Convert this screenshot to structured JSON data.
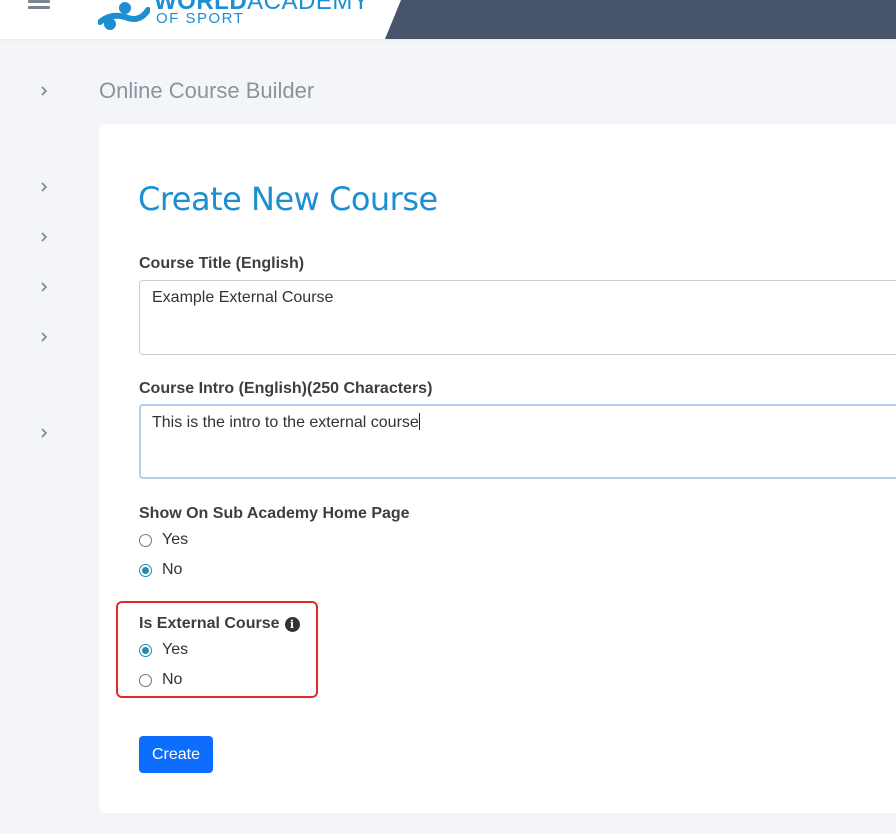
{
  "header": {
    "logo_brand_bold": "WORLD",
    "logo_brand_light": "ACADEMY",
    "logo_subtitle": "OF SPORT",
    "menu_icon": "hamburger-icon",
    "band_color": "#47546a"
  },
  "sidebar": {
    "icon": "chevron-right-icon",
    "item_count": 6
  },
  "page": {
    "title": "Online Course Builder"
  },
  "form": {
    "heading": "Create New Course",
    "course_title": {
      "label": "Course Title (English)",
      "value": "Example External Course"
    },
    "course_intro": {
      "label": "Course Intro (English)(250 Characters)",
      "value": "This is the intro to the external course"
    },
    "show_on_home": {
      "label": "Show On Sub Academy Home Page",
      "options": [
        "Yes",
        "No"
      ],
      "selected": "No"
    },
    "is_external": {
      "label": "Is External Course",
      "info_icon": "info-circle-icon",
      "info_glyph": "i",
      "options": [
        "Yes",
        "No"
      ],
      "selected": "Yes"
    },
    "submit_label": "Create"
  },
  "colors": {
    "accent": "#1b8fd2",
    "primary_button": "#0d6efd",
    "radio_checked": "#1a8fb0",
    "highlight": "#e02b2b"
  }
}
